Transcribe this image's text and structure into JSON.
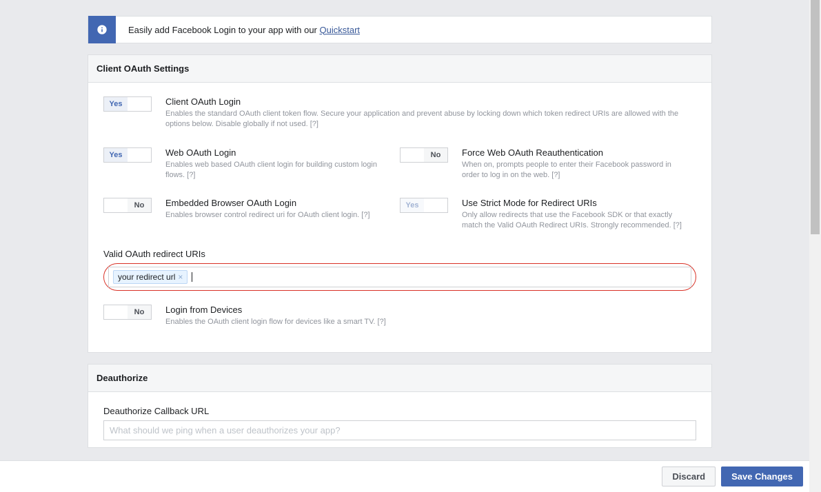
{
  "banner": {
    "text_prefix": "Easily add Facebook Login to your app with our ",
    "link_text": "Quickstart"
  },
  "sections": {
    "oauth": {
      "title": "Client OAuth Settings",
      "client_oauth": {
        "toggle": "Yes",
        "title": "Client OAuth Login",
        "desc": "Enables the standard OAuth client token flow. Secure your application and prevent abuse by locking down which token redirect URIs are allowed with the options below. Disable globally if not used.  [?]"
      },
      "web_oauth": {
        "toggle": "Yes",
        "title": "Web OAuth Login",
        "desc": "Enables web based OAuth client login for building custom login flows.  [?]"
      },
      "force_reauth": {
        "toggle": "No",
        "title": "Force Web OAuth Reauthentication",
        "desc": "When on, prompts people to enter their Facebook password in order to log in on the web.  [?]"
      },
      "embedded": {
        "toggle": "No",
        "title": "Embedded Browser OAuth Login",
        "desc": "Enables browser control redirect uri for OAuth client login.  [?]"
      },
      "strict": {
        "toggle": "Yes",
        "title": "Use Strict Mode for Redirect URIs",
        "desc": "Only allow redirects that use the Facebook SDK or that exactly match the Valid OAuth Redirect URIs. Strongly recommended.  [?]"
      },
      "redirect_uris": {
        "label": "Valid OAuth redirect URIs",
        "tag": "your redirect url"
      },
      "login_devices": {
        "toggle": "No",
        "title": "Login from Devices",
        "desc": "Enables the OAuth client login flow for devices like a smart TV.  [?]"
      }
    },
    "deauth": {
      "title": "Deauthorize",
      "callback_label": "Deauthorize Callback URL",
      "callback_placeholder": "What should we ping when a user deauthorizes your app?"
    }
  },
  "toggle_labels": {
    "yes": "Yes",
    "no": "No"
  },
  "footer": {
    "discard": "Discard",
    "save": "Save Changes"
  }
}
